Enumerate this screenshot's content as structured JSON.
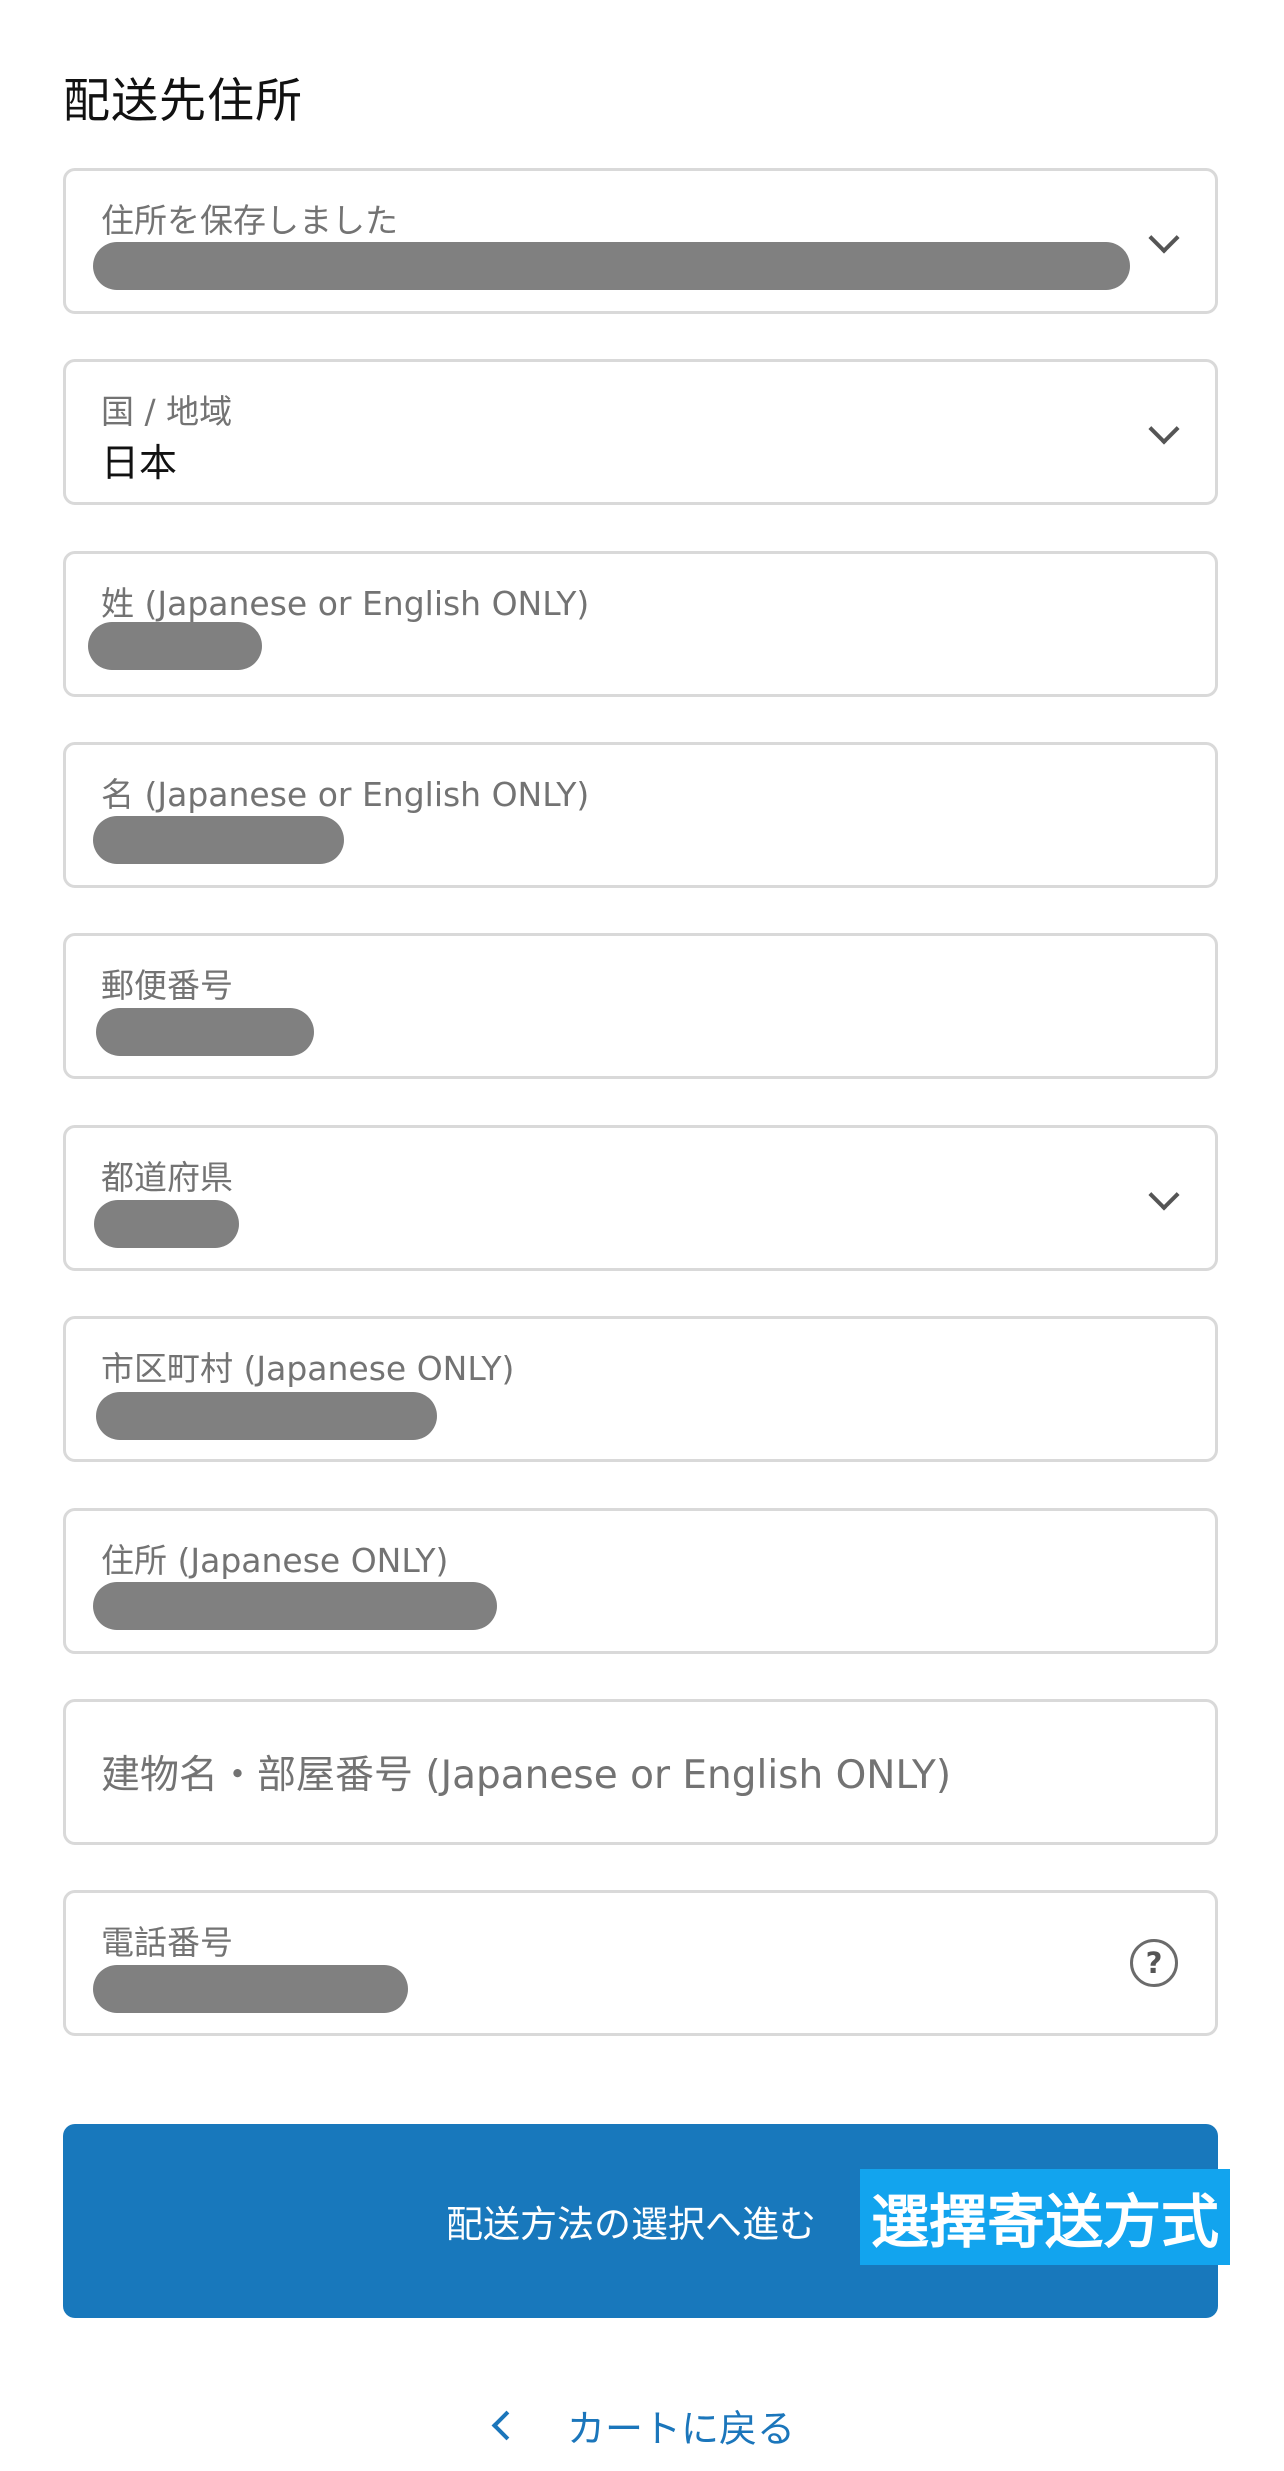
{
  "section": {
    "title": "配送先住所"
  },
  "fields": {
    "saved_address": {
      "label": "住所を保存しました"
    },
    "country": {
      "label": "国 / 地域",
      "value": "日本"
    },
    "last_name": {
      "label": "姓 (Japanese or English ONLY)"
    },
    "first_name": {
      "label": "名 (Japanese or English ONLY)"
    },
    "postal_code": {
      "label": "郵便番号"
    },
    "prefecture": {
      "label": "都道府県"
    },
    "city": {
      "label": "市区町村 (Japanese ONLY)"
    },
    "address": {
      "label": "住所 (Japanese ONLY)"
    },
    "building": {
      "placeholder": "建物名・部屋番号 (Japanese or English ONLY)"
    },
    "phone": {
      "label": "電話番号",
      "help_icon": "?"
    }
  },
  "actions": {
    "continue_label": "配送方法の選択へ進む",
    "overlay_text": "選擇寄送方式",
    "back_label": "カートに戻る"
  },
  "icons": {
    "dropdown": "chevron-down-icon",
    "help": "question-circle-icon",
    "back": "chevron-left-icon"
  },
  "colors": {
    "primary": "#1878bc",
    "overlay": "#12a4ee",
    "link": "#1b76bb",
    "redaction": "#808080"
  }
}
